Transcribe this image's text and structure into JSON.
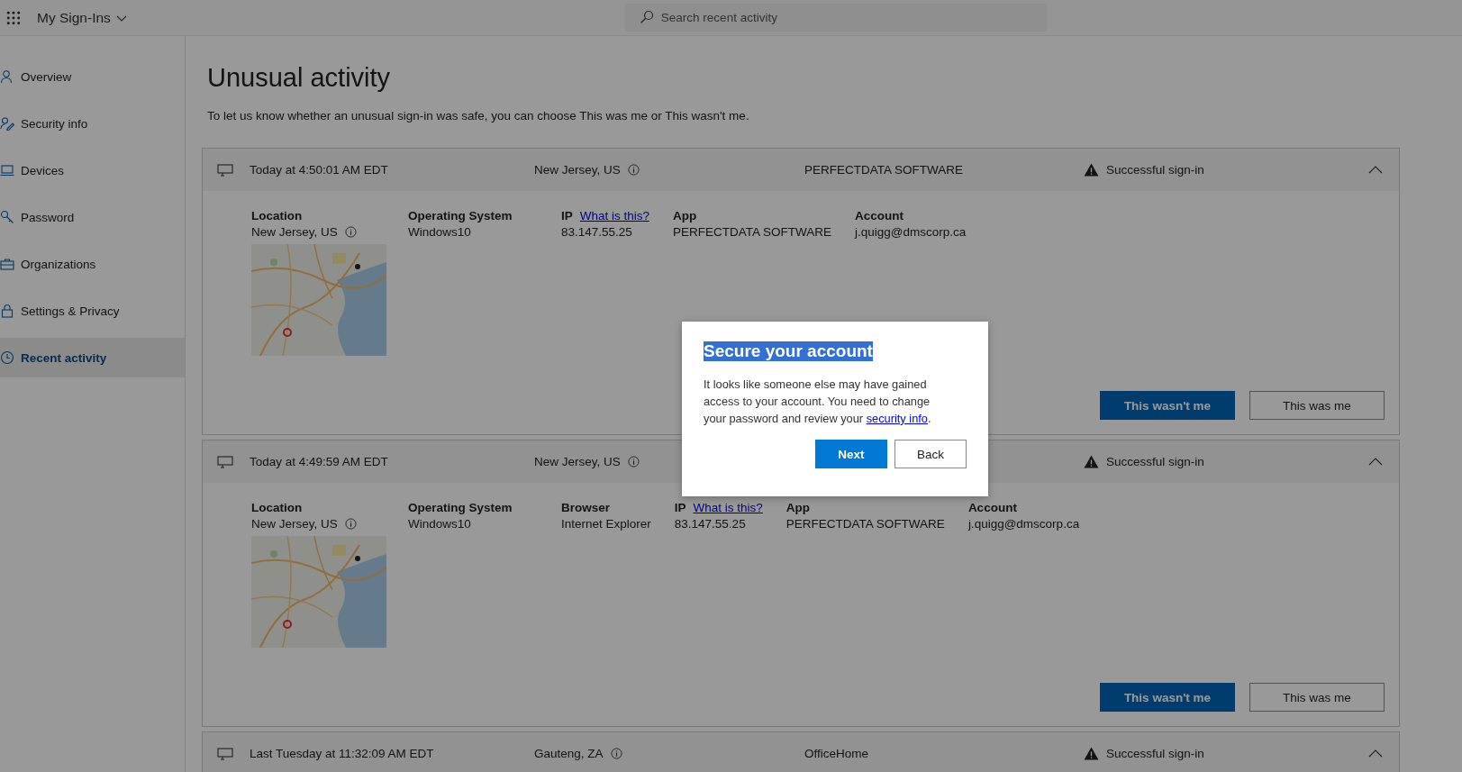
{
  "header": {
    "app_title": "My Sign-Ins",
    "search": {
      "placeholder": "Search recent activity"
    }
  },
  "sidebar": {
    "items": [
      {
        "label": "Overview",
        "selected": false
      },
      {
        "label": "Security info",
        "selected": false
      },
      {
        "label": "Devices",
        "selected": false
      },
      {
        "label": "Password",
        "selected": false
      },
      {
        "label": "Organizations",
        "selected": false
      },
      {
        "label": "Settings & Privacy",
        "selected": false
      },
      {
        "label": "Recent activity",
        "selected": true
      }
    ]
  },
  "page": {
    "title": "Unusual activity",
    "description": "To let us know whether an unusual sign-in was safe, you can choose This was me or This wasn't me."
  },
  "activities": [
    {
      "time": "Today at 4:50:01 AM EDT",
      "location": "New Jersey, US",
      "app": "PERFECTDATA SOFTWARE",
      "status": "Successful sign-in",
      "details": [
        {
          "kind": "location",
          "label": "Location",
          "value": "New Jersey, US"
        },
        {
          "kind": "text",
          "label": "Operating System",
          "value": "Windows10"
        },
        {
          "kind": "ip",
          "label": "IP",
          "link": "What is this?",
          "value": "83.147.55.25"
        },
        {
          "kind": "text",
          "label": "App",
          "value": "PERFECTDATA SOFTWARE"
        },
        {
          "kind": "text",
          "label": "Account",
          "value": "j.quigg@dmscorp.ca"
        }
      ],
      "actions": [
        {
          "label": "This wasn't me",
          "kind": "primary"
        },
        {
          "label": "This was me",
          "kind": "secondary"
        }
      ]
    },
    {
      "time": "Today at 4:49:59 AM EDT",
      "location": "New Jersey, US",
      "status": "Successful sign-in",
      "details": [
        {
          "kind": "location",
          "label": "Location",
          "value": "New Jersey, US"
        },
        {
          "kind": "text",
          "label": "Operating System",
          "value": "Windows10"
        },
        {
          "kind": "text",
          "label": "Browser",
          "value": "Internet Explorer"
        },
        {
          "kind": "ip",
          "label": "IP",
          "link": "What is this?",
          "value": "83.147.55.25"
        },
        {
          "kind": "text",
          "label": "App",
          "value": "PERFECTDATA SOFTWARE"
        },
        {
          "kind": "text",
          "label": "Account",
          "value": "j.quigg@dmscorp.ca"
        }
      ],
      "actions": [
        {
          "label": "This wasn't me",
          "kind": "primary"
        },
        {
          "label": "This was me",
          "kind": "secondary"
        }
      ]
    },
    {
      "time": "Last Tuesday at 11:32:09 AM EDT",
      "location": "Gauteng, ZA",
      "app": "OfficeHome",
      "status": "Successful sign-in"
    }
  ],
  "dialog": {
    "title": "Secure your account",
    "title_highlighted": true,
    "body_before": "It looks like someone else may have gained access to your account. You need to change your password and review your ",
    "link": "security info",
    "body_after": ".",
    "buttons": [
      {
        "label": "Next",
        "kind": "primary"
      },
      {
        "label": "Back",
        "kind": "secondary"
      }
    ]
  }
}
